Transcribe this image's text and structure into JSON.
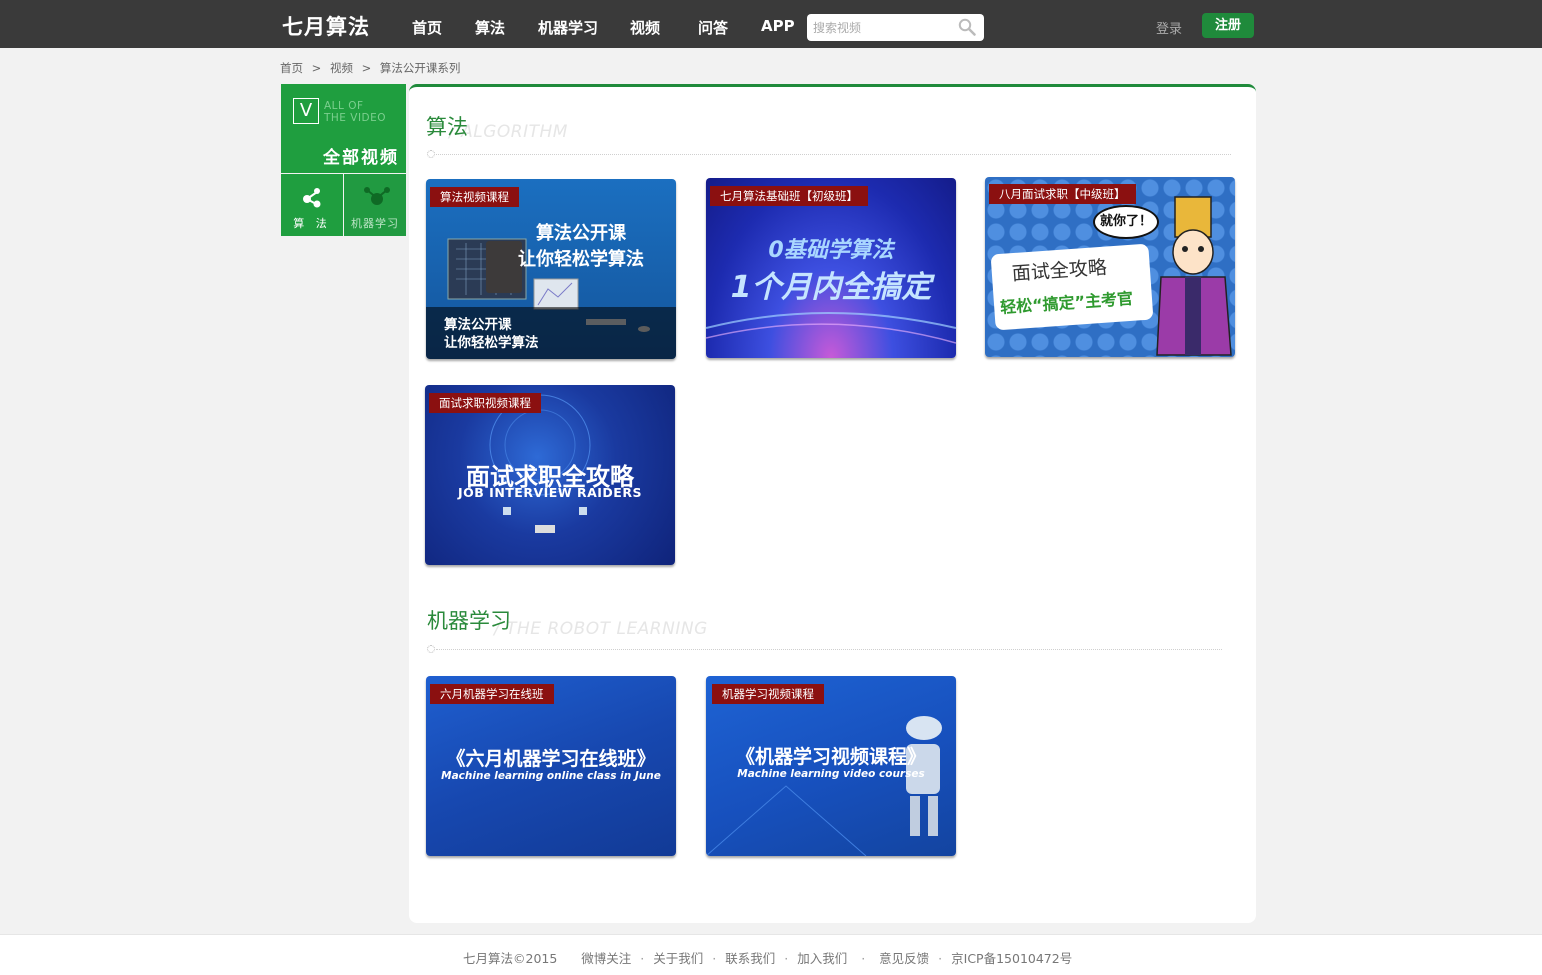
{
  "header": {
    "logo": "七月算法",
    "nav": [
      "首页",
      "算法",
      "机器学习",
      "视频",
      "问答",
      "APP"
    ],
    "search_placeholder": "搜索视频",
    "login": "登录",
    "register": "注册"
  },
  "breadcrumb": [
    "首页",
    "视频",
    "算法公开课系列"
  ],
  "breadcrumb_sep": ">",
  "sidebar": {
    "all_en_line1": "ALL OF",
    "all_en_line2": "THE VIDEO",
    "all_title": "全部视频",
    "all_icon_letter": "V",
    "cat_algo": "算 法",
    "cat_ml": "机器学习"
  },
  "sections": {
    "algo": {
      "title": "算法",
      "en": "/ ALGORITHM",
      "cards": [
        {
          "tag": "算法视频课程",
          "line1": "算法公开课",
          "line2": "让你轻松学算法",
          "sub1": "算法公开课",
          "sub2": "让你轻松学算法"
        },
        {
          "tag": "七月算法基础班【初级班】",
          "line1": "0基础学算法",
          "line2": "1个月内全搞定"
        },
        {
          "tag": "八月面试求职【中级班】",
          "bubble": "就你了！",
          "line1": "面试全攻略",
          "line2": "轻松“搞定”主考官"
        },
        {
          "tag": "面试求职视频课程",
          "line1": "面试求职全攻略",
          "line2": "JOB INTERVIEW RAIDERS"
        }
      ]
    },
    "ml": {
      "title": "机器学习",
      "en": "/ THE ROBOT LEARNING",
      "cards": [
        {
          "tag": "六月机器学习在线班",
          "line1": "《六月机器学习在线班》",
          "line2": "Machine learning online class in June"
        },
        {
          "tag": "机器学习视频课程",
          "line1": "《机器学习视频课程》",
          "line2": "Machine learning video courses"
        }
      ]
    }
  },
  "footer": {
    "copyright": "七月算法©2015",
    "links": [
      "微博关注",
      "关于我们",
      "联系我们",
      "加入我们",
      "意见反馈",
      "京ICP备15010472号"
    ]
  },
  "colors": {
    "brand_green": "#1f9e3f",
    "tag_red": "#8b1010",
    "header_bg": "#3a3a3a"
  }
}
